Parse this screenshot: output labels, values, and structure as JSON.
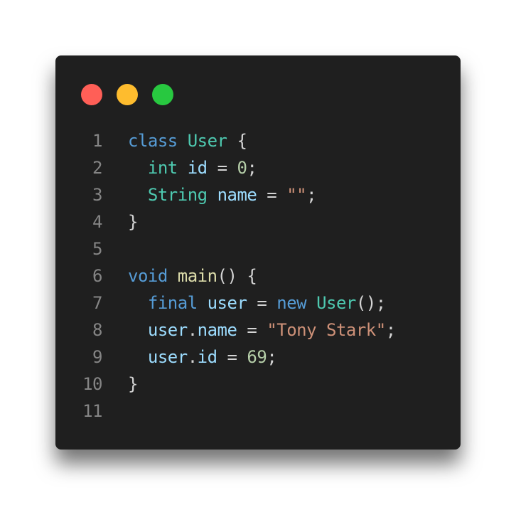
{
  "window": {
    "controls": [
      {
        "name": "close",
        "color": "#ff5f57"
      },
      {
        "name": "minimize",
        "color": "#febc2e"
      },
      {
        "name": "maximize",
        "color": "#28c840"
      }
    ]
  },
  "code": {
    "language": "dart",
    "lines": [
      {
        "number": "1",
        "tokens": [
          {
            "t": "class",
            "c": "kw"
          },
          {
            "t": " ",
            "c": "pn"
          },
          {
            "t": "User",
            "c": "ty"
          },
          {
            "t": " {",
            "c": "pn"
          }
        ]
      },
      {
        "number": "2",
        "tokens": [
          {
            "t": "  ",
            "c": "pn"
          },
          {
            "t": "int",
            "c": "ty"
          },
          {
            "t": " ",
            "c": "pn"
          },
          {
            "t": "id",
            "c": "var"
          },
          {
            "t": " = ",
            "c": "pn"
          },
          {
            "t": "0",
            "c": "num"
          },
          {
            "t": ";",
            "c": "pn"
          }
        ]
      },
      {
        "number": "3",
        "tokens": [
          {
            "t": "  ",
            "c": "pn"
          },
          {
            "t": "String",
            "c": "ty"
          },
          {
            "t": " ",
            "c": "pn"
          },
          {
            "t": "name",
            "c": "var"
          },
          {
            "t": " = ",
            "c": "pn"
          },
          {
            "t": "\"\"",
            "c": "str"
          },
          {
            "t": ";",
            "c": "pn"
          }
        ]
      },
      {
        "number": "4",
        "tokens": [
          {
            "t": "}",
            "c": "pn"
          }
        ]
      },
      {
        "number": "5",
        "tokens": []
      },
      {
        "number": "6",
        "tokens": [
          {
            "t": "void",
            "c": "kw"
          },
          {
            "t": " ",
            "c": "pn"
          },
          {
            "t": "main",
            "c": "fn"
          },
          {
            "t": "() {",
            "c": "pn"
          }
        ]
      },
      {
        "number": "7",
        "tokens": [
          {
            "t": "  ",
            "c": "pn"
          },
          {
            "t": "final",
            "c": "kw"
          },
          {
            "t": " ",
            "c": "pn"
          },
          {
            "t": "user",
            "c": "var"
          },
          {
            "t": " = ",
            "c": "pn"
          },
          {
            "t": "new",
            "c": "kw"
          },
          {
            "t": " ",
            "c": "pn"
          },
          {
            "t": "User",
            "c": "ty"
          },
          {
            "t": "();",
            "c": "pn"
          }
        ]
      },
      {
        "number": "8",
        "tokens": [
          {
            "t": "  ",
            "c": "pn"
          },
          {
            "t": "user",
            "c": "var"
          },
          {
            "t": ".",
            "c": "pn"
          },
          {
            "t": "name",
            "c": "var"
          },
          {
            "t": " = ",
            "c": "pn"
          },
          {
            "t": "\"Tony Stark\"",
            "c": "str"
          },
          {
            "t": ";",
            "c": "pn"
          }
        ]
      },
      {
        "number": "9",
        "tokens": [
          {
            "t": "  ",
            "c": "pn"
          },
          {
            "t": "user",
            "c": "var"
          },
          {
            "t": ".",
            "c": "pn"
          },
          {
            "t": "id",
            "c": "var"
          },
          {
            "t": " = ",
            "c": "pn"
          },
          {
            "t": "69",
            "c": "num"
          },
          {
            "t": ";",
            "c": "pn"
          }
        ]
      },
      {
        "number": "10",
        "tokens": [
          {
            "t": "}",
            "c": "pn"
          }
        ]
      },
      {
        "number": "11",
        "tokens": []
      }
    ]
  }
}
